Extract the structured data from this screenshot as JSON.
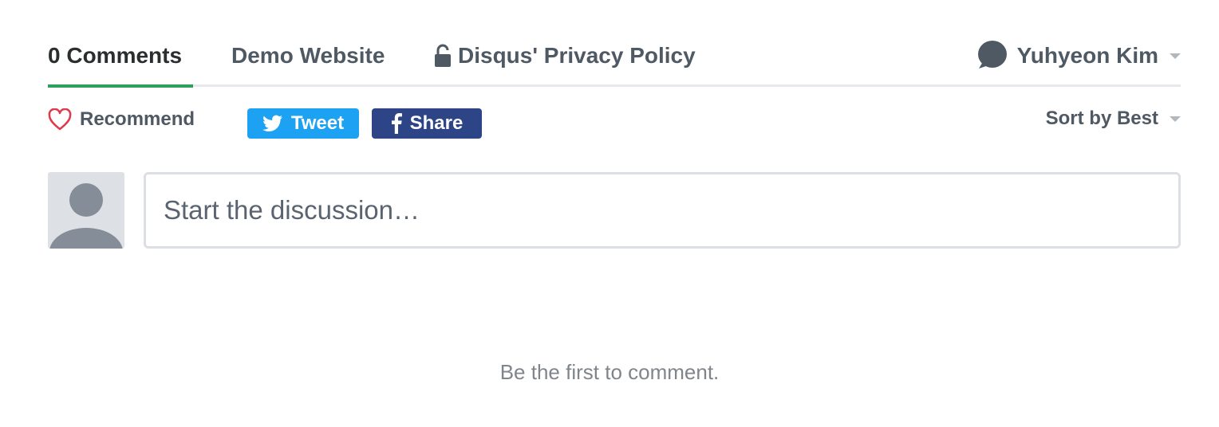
{
  "nav": {
    "tabs": [
      {
        "label": "0 Comments",
        "active": true
      },
      {
        "label": "Demo Website",
        "active": false
      },
      {
        "label": "Disqus' Privacy Policy",
        "active": false,
        "icon": "lock-icon"
      }
    ],
    "user": {
      "name": "Yuhyeon Kim",
      "icon": "speech-bubble-icon"
    }
  },
  "actions": {
    "recommend_label": "Recommend",
    "tweet_label": "Tweet",
    "share_label": "Share",
    "sort_label": "Sort by Best"
  },
  "composer": {
    "placeholder": "Start the discussion…"
  },
  "empty_state": "Be the first to comment.",
  "colors": {
    "accent_green": "#2e9f5c",
    "twitter_blue": "#1da1f2",
    "facebook_blue": "#2d4486",
    "heart_red": "#e0394b",
    "text": "#4f5964"
  }
}
